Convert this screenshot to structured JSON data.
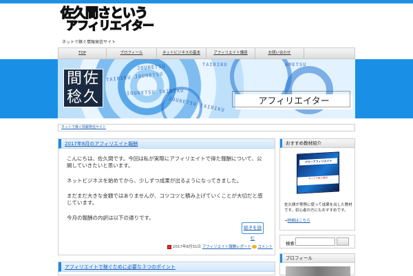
{
  "site": {
    "logo_line1": "佐久間さという",
    "logo_line2": "アフィリエイター",
    "tagline": "ネットで稼ぐ情報発信サイト"
  },
  "nav": {
    "items": [
      {
        "label": "TOP"
      },
      {
        "label": "プロフィール"
      },
      {
        "label": "ネットビジネスの基本"
      },
      {
        "label": "アフィリエイト講座"
      },
      {
        "label": "お問い合わせ"
      }
    ]
  },
  "hero": {
    "name_chars": [
      "間",
      "佐",
      "稔",
      "久"
    ],
    "title": "アフィリエイター",
    "overlay_words": [
      "JOUNETSU",
      "TAIRIKU",
      "AMETSU",
      "TAIRIKU JOUNETSU",
      "IOUNETSU TAIRIKU",
      "JOUNETSU TAIRIKU"
    ]
  },
  "breadcrumb": "ネットで稼ぐ情報発信サイト",
  "post": {
    "title": "2017年8月のアフィリエイト報酬",
    "paragraphs": [
      "こんにちは、佐久間です。今回は私が実際にアフィリエイトで得た報酬について、公開していきたいと思います。",
      "ネットビジネスを始めてから、少しずつ成果が出るようになってきました。",
      "まだまだ大きな金額ではありませんが、コツコツと積み上げていくことが大切だと感じています。",
      "今月の報酬の内訳は以下の通りです。"
    ],
    "more_label": "続きを読む",
    "date": "2017年8月31日",
    "category": "アフィリエイト報酬レポート",
    "comments": "コメント"
  },
  "post2": {
    "title": "アフィリエイトで稼ぐために必要な３つのポイント"
  },
  "sidebar": {
    "product_heading": "おすすめ教材紹介",
    "product_top_text": "パワーアフィリエイト",
    "product_band_text": "ネットで稼ぐ教材",
    "product_desc": "佐久間が実際に使って成果を出した教材です。初心者の方にもおすすめです。",
    "product_link_prefix": "→",
    "product_link": "詳細はこちら",
    "search_label": "検索",
    "profile_heading": "プロフィール"
  },
  "colors": {
    "accent": "#1e90e6",
    "link": "#1a5fb4",
    "name_box": "#1a2a40"
  }
}
